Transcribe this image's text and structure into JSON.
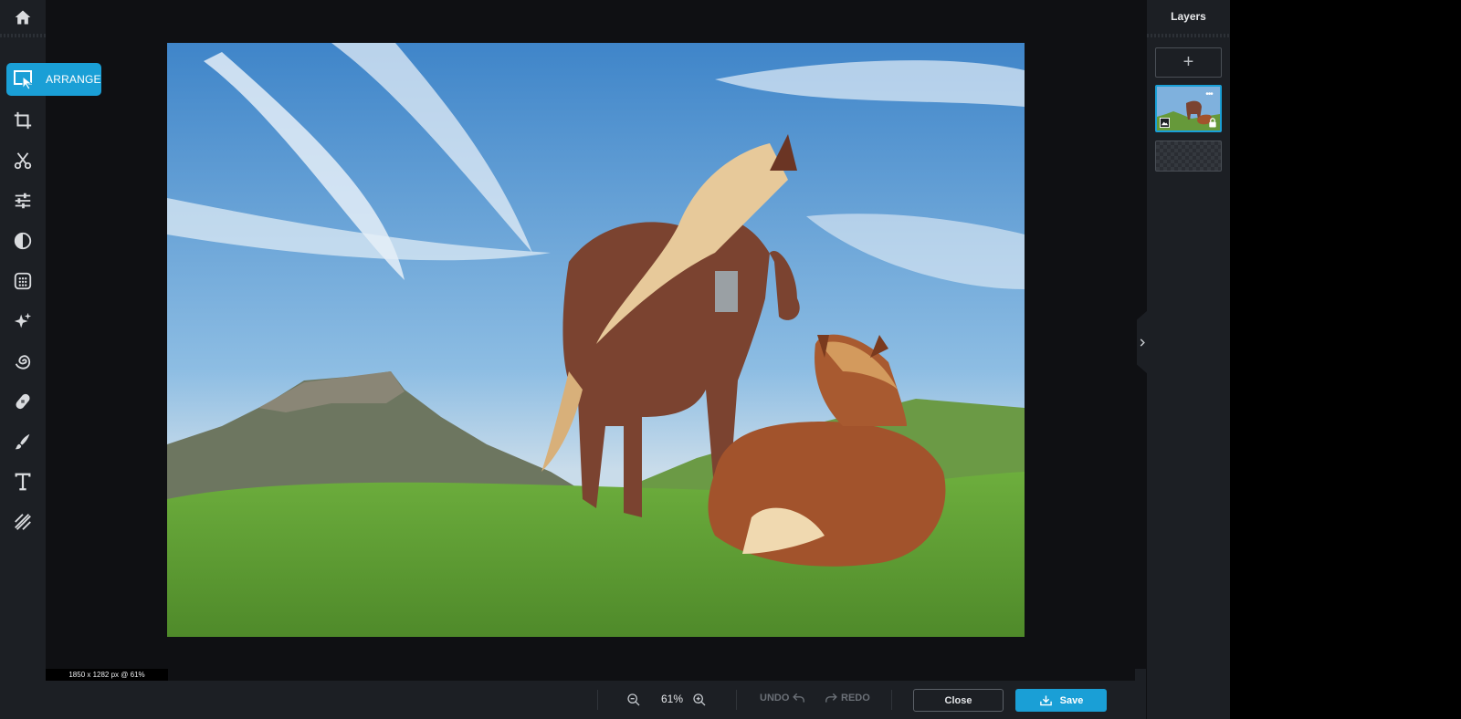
{
  "toolbar": {
    "active_tool_label": "ARRANGE",
    "tools": [
      "home-icon",
      "arrange-icon",
      "crop-icon",
      "cut-icon",
      "adjust-icon",
      "filter-icon",
      "effects-icon",
      "magic-icon",
      "distort-icon",
      "retouch-icon",
      "paint-icon",
      "text-icon",
      "texture-icon"
    ]
  },
  "canvas": {
    "dimensions_label": "1850 x 1282 px @ 61%"
  },
  "bottombar": {
    "zoom_value": "61%",
    "undo_label": "UNDO",
    "redo_label": "REDO",
    "close_label": "Close",
    "save_label": "Save"
  },
  "layers": {
    "title": "Layers",
    "add_label": "+",
    "menu_label": "•••"
  },
  "colors": {
    "accent": "#1a9fd6",
    "panel": "#1c1f24",
    "canvas_bg": "#0f1013"
  }
}
